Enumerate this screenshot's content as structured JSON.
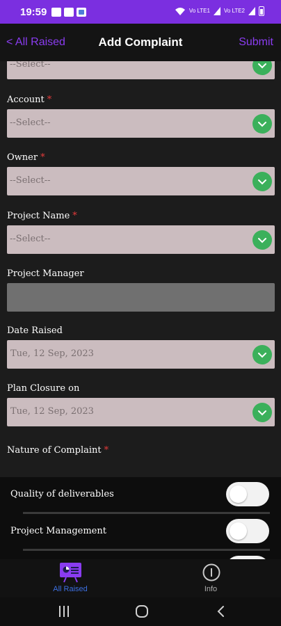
{
  "status_bar": {
    "time": "19:59",
    "signal_1": "Vo LTE1",
    "signal_2": "Vo LTE2"
  },
  "nav": {
    "back_label": "< All Raised",
    "title": "Add Complaint",
    "submit_label": "Submit"
  },
  "form": {
    "partial_select_value": "--Select--",
    "account": {
      "label": "Account",
      "required": "*",
      "value": "--Select--"
    },
    "owner": {
      "label": "Owner",
      "required": "*",
      "value": "--Select--"
    },
    "project_name": {
      "label": "Project Name",
      "required": "*",
      "value": "--Select--"
    },
    "project_manager": {
      "label": "Project Manager",
      "value": ""
    },
    "date_raised": {
      "label": "Date Raised",
      "value": "Tue, 12 Sep, 2023"
    },
    "plan_closure": {
      "label": "Plan Closure on",
      "value": "Tue, 12 Sep, 2023"
    },
    "nature": {
      "label": "Nature of Complaint",
      "required": "*"
    }
  },
  "toggles": [
    {
      "label": "Quality of deliverables",
      "on": false
    },
    {
      "label": "Project Management",
      "on": false
    }
  ],
  "tabs": [
    {
      "label": "All Raised",
      "icon": "presentation-board-icon",
      "active": true
    },
    {
      "label": "Info",
      "icon": "info-icon",
      "active": false
    }
  ],
  "colors": {
    "accent": "#8a3cf0",
    "status_bar": "#7b2fe0",
    "select_bg": "#cbbcbf",
    "chevron_bg": "#3bb05b",
    "required": "#e23a3a",
    "active_tab": "#3c6fe0"
  }
}
